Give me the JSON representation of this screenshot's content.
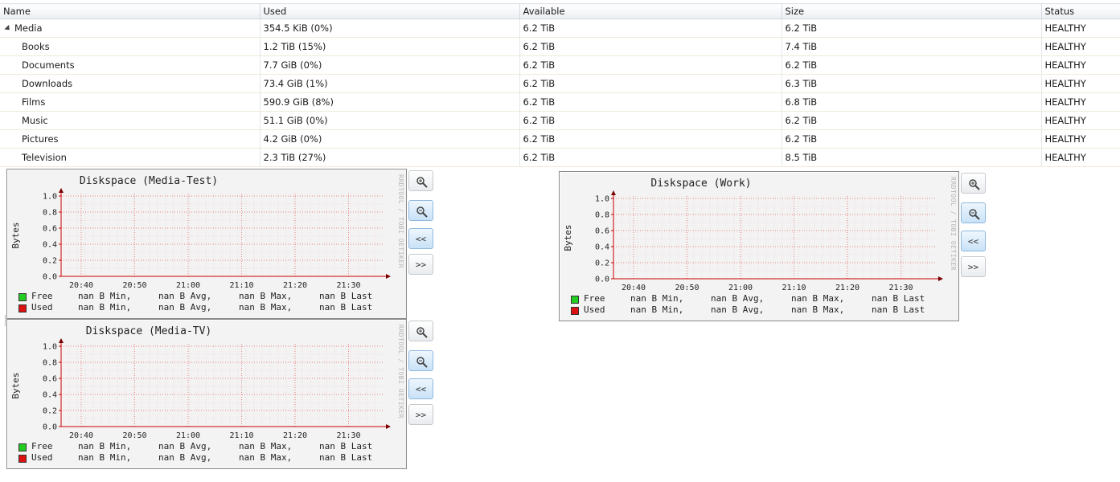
{
  "table": {
    "columns": [
      "Name",
      "Used",
      "Available",
      "Size",
      "Status"
    ],
    "rows": [
      {
        "name": "Media",
        "used": "354.5 KiB (0%)",
        "available": "6.2 TiB",
        "size": "6.2 TiB",
        "status": "HEALTHY"
      },
      {
        "name": "Books",
        "used": "1.2 TiB (15%)",
        "available": "6.2 TiB",
        "size": "7.4 TiB",
        "status": "HEALTHY"
      },
      {
        "name": "Documents",
        "used": "7.7 GiB (0%)",
        "available": "6.2 TiB",
        "size": "6.2 TiB",
        "status": "HEALTHY"
      },
      {
        "name": "Downloads",
        "used": "73.4 GiB (1%)",
        "available": "6.2 TiB",
        "size": "6.3 TiB",
        "status": "HEALTHY"
      },
      {
        "name": "Films",
        "used": "590.9 GiB (8%)",
        "available": "6.2 TiB",
        "size": "6.8 TiB",
        "status": "HEALTHY"
      },
      {
        "name": "Music",
        "used": "51.1 GiB (0%)",
        "available": "6.2 TiB",
        "size": "6.2 TiB",
        "status": "HEALTHY"
      },
      {
        "name": "Pictures",
        "used": "4.2 GiB (0%)",
        "available": "6.2 TiB",
        "size": "6.2 TiB",
        "status": "HEALTHY"
      },
      {
        "name": "Television",
        "used": "2.3 TiB (27%)",
        "available": "6.2 TiB",
        "size": "8.5 TiB",
        "status": "HEALTHY"
      }
    ]
  },
  "graph_buttons": {
    "zoom_in_icon": "zoom-in-icon",
    "zoom_out_icon": "zoom-out-icon",
    "back_label": "<<",
    "forward_label": ">>"
  },
  "watermark": "RRDTOOL / TOBI OETIKER",
  "legend_colors": {
    "free": "#22cc22",
    "used": "#dd1111"
  },
  "graphs": [
    {
      "title": "Diskspace (Media-Test)",
      "ylabel": "Bytes",
      "legend": [
        {
          "name": "Free",
          "min": "nan B Min,",
          "avg": "nan B Avg,",
          "max": "nan B Max,",
          "last": "nan B Last"
        },
        {
          "name": "Used",
          "min": "nan B Min,",
          "avg": "nan B Avg,",
          "max": "nan B Max,",
          "last": "nan B Last"
        }
      ]
    },
    {
      "title": "Diskspace (Work)",
      "ylabel": "Bytes",
      "legend": [
        {
          "name": "Free",
          "min": "nan B Min,",
          "avg": "nan B Avg,",
          "max": "nan B Max,",
          "last": "nan B Last"
        },
        {
          "name": "Used",
          "min": "nan B Min,",
          "avg": "nan B Avg,",
          "max": "nan B Max,",
          "last": "nan B Last"
        }
      ]
    },
    {
      "title": "Diskspace (Media-TV)",
      "ylabel": "Bytes",
      "legend": [
        {
          "name": "Free",
          "min": "nan B Min,",
          "avg": "nan B Avg,",
          "max": "nan B Max,",
          "last": "nan B Last"
        },
        {
          "name": "Used",
          "min": "nan B Min,",
          "avg": "nan B Avg,",
          "max": "nan B Max,",
          "last": "nan B Last"
        }
      ]
    }
  ],
  "chart_data": [
    {
      "type": "line",
      "title": "Diskspace (Media-Test)",
      "xlabel": "",
      "ylabel": "Bytes",
      "ylim": [
        0,
        1.0
      ],
      "yticks": [
        "0.0",
        "0.2",
        "0.4",
        "0.6",
        "0.8",
        "1.0"
      ],
      "xticks": [
        "20:40",
        "20:50",
        "21:00",
        "21:10",
        "21:20",
        "21:30"
      ],
      "grid": true,
      "series": [
        {
          "name": "Free",
          "values": []
        },
        {
          "name": "Used",
          "values": []
        }
      ]
    },
    {
      "type": "line",
      "title": "Diskspace (Work)",
      "xlabel": "",
      "ylabel": "Bytes",
      "ylim": [
        0,
        1.0
      ],
      "yticks": [
        "0.0",
        "0.2",
        "0.4",
        "0.6",
        "0.8",
        "1.0"
      ],
      "xticks": [
        "20:40",
        "20:50",
        "21:00",
        "21:10",
        "21:20",
        "21:30"
      ],
      "grid": true,
      "series": [
        {
          "name": "Free",
          "values": []
        },
        {
          "name": "Used",
          "values": []
        }
      ]
    },
    {
      "type": "line",
      "title": "Diskspace (Media-TV)",
      "xlabel": "",
      "ylabel": "Bytes",
      "ylim": [
        0,
        1.0
      ],
      "yticks": [
        "0.0",
        "0.2",
        "0.4",
        "0.6",
        "0.8",
        "1.0"
      ],
      "xticks": [
        "20:40",
        "20:50",
        "21:00",
        "21:10",
        "21:20",
        "21:30"
      ],
      "grid": true,
      "series": [
        {
          "name": "Free",
          "values": []
        },
        {
          "name": "Used",
          "values": []
        }
      ]
    }
  ]
}
